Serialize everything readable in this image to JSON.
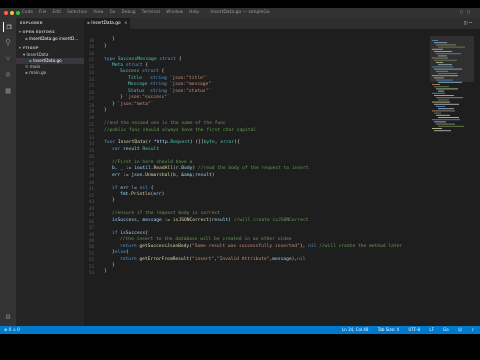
{
  "window": {
    "title": "InsertData.go — simpleGo"
  },
  "menubar": [
    "Code",
    "File",
    "Edit",
    "Selection",
    "View",
    "Go",
    "Debug",
    "Terminal",
    "Window",
    "Help"
  ],
  "colors": {
    "accent": "#007acc",
    "editor_bg": "#1e1e1e",
    "sidebar_bg": "#252526",
    "keyword": "#569cd6",
    "type": "#4ec9b0",
    "string": "#ce9178",
    "function": "#dcdcaa",
    "comment": "#6a9955",
    "variable": "#9cdcfe"
  },
  "activity_icons": [
    "files-icon",
    "search-icon",
    "source-control-icon",
    "debug-icon",
    "extensions-icon"
  ],
  "sidebar": {
    "header": "EXPLORER",
    "open_editors": {
      "label": "OPEN EDITORS",
      "items": [
        "InsertData.go  insertD..."
      ]
    },
    "project": {
      "label": "YTIGOP",
      "folder": "InsertData",
      "items": [
        "InsertData.go",
        "main",
        "main.go"
      ]
    }
  },
  "tab": {
    "label": "InsertData.go"
  },
  "code": [
    {
      "n": "18",
      "indent": 1,
      "text": "}"
    },
    {
      "n": "19",
      "indent": 0,
      "text": "}"
    },
    {
      "n": "20",
      "indent": 0,
      "text": ""
    },
    {
      "n": "21",
      "indent": 0,
      "text": "type SuccessMessage struct {"
    },
    {
      "n": "22",
      "indent": 1,
      "text": "Meta struct {"
    },
    {
      "n": "23",
      "indent": 2,
      "text": "Success struct {"
    },
    {
      "n": "24",
      "indent": 3,
      "text": "Title   string `json:\"title\"`"
    },
    {
      "n": "25",
      "indent": 3,
      "text": "Message string `json:\"message\"`"
    },
    {
      "n": "26",
      "indent": 3,
      "text": "Status  string `json:\"status\"`"
    },
    {
      "n": "27",
      "indent": 2,
      "text": "} `json:\"success\"`"
    },
    {
      "n": "28",
      "indent": 1,
      "text": "} `json:\"meta\"`"
    },
    {
      "n": "29",
      "indent": 0,
      "text": "}"
    },
    {
      "n": "30",
      "indent": 0,
      "text": ""
    },
    {
      "n": "31",
      "indent": 0,
      "text": "//and the second one is the name of the func"
    },
    {
      "n": "32",
      "indent": 0,
      "text": "//public func should always have the first char capital"
    },
    {
      "n": "33",
      "indent": 0,
      "text": ""
    },
    {
      "n": "34",
      "indent": 0,
      "text": "func InsertData(r *http.Request) ([]byte, error){"
    },
    {
      "n": "35",
      "indent": 1,
      "text": "var result Result"
    },
    {
      "n": "36",
      "indent": 0,
      "text": ""
    },
    {
      "n": "37",
      "indent": 1,
      "text": "//First in here should have a"
    },
    {
      "n": "38",
      "indent": 1,
      "text": "b, _ := ioutil.ReadAll(r.Body) //read the body of the request to insert"
    },
    {
      "n": "39",
      "indent": 1,
      "text": "err := json.Unmarshal(b, &result)"
    },
    {
      "n": "40",
      "indent": 0,
      "text": ""
    },
    {
      "n": "41",
      "indent": 1,
      "text": "if err != nil {"
    },
    {
      "n": "42",
      "indent": 2,
      "text": "fmt.Println(err)"
    },
    {
      "n": "43",
      "indent": 1,
      "text": "}"
    },
    {
      "n": "44",
      "indent": 0,
      "text": ""
    },
    {
      "n": "45",
      "indent": 1,
      "text": "//ensure if the request body is correct"
    },
    {
      "n": "46",
      "indent": 1,
      "text": "isSuccess, message := isJSONCorrect(result) //will create isJSONCorrect"
    },
    {
      "n": "47",
      "indent": 0,
      "text": ""
    },
    {
      "n": "48",
      "indent": 1,
      "text": "if isSuccess{"
    },
    {
      "n": "49",
      "indent": 2,
      "text": "//the insert to the database will be created in an other video"
    },
    {
      "n": "50",
      "indent": 2,
      "text": "return getSuccessJsonBody(\"Some result was successfully inserted\"), nil //will create the method later"
    },
    {
      "n": "51",
      "indent": 1,
      "text": "}else{"
    },
    {
      "n": "52",
      "indent": 2,
      "text": "return getErrorFromResult(\"insert\",\"Invalid Attribute\",message),nil"
    },
    {
      "n": "53",
      "indent": 1,
      "text": "}"
    },
    {
      "n": "54",
      "indent": 0,
      "text": "}"
    }
  ],
  "statusbar": {
    "left": "⊗ 0  ⚠ 0",
    "position": "Ln 34, Col 48",
    "tab_size": "Tab Size: 4",
    "encoding": "UTF-8",
    "eol": "LF",
    "language": "Go"
  }
}
